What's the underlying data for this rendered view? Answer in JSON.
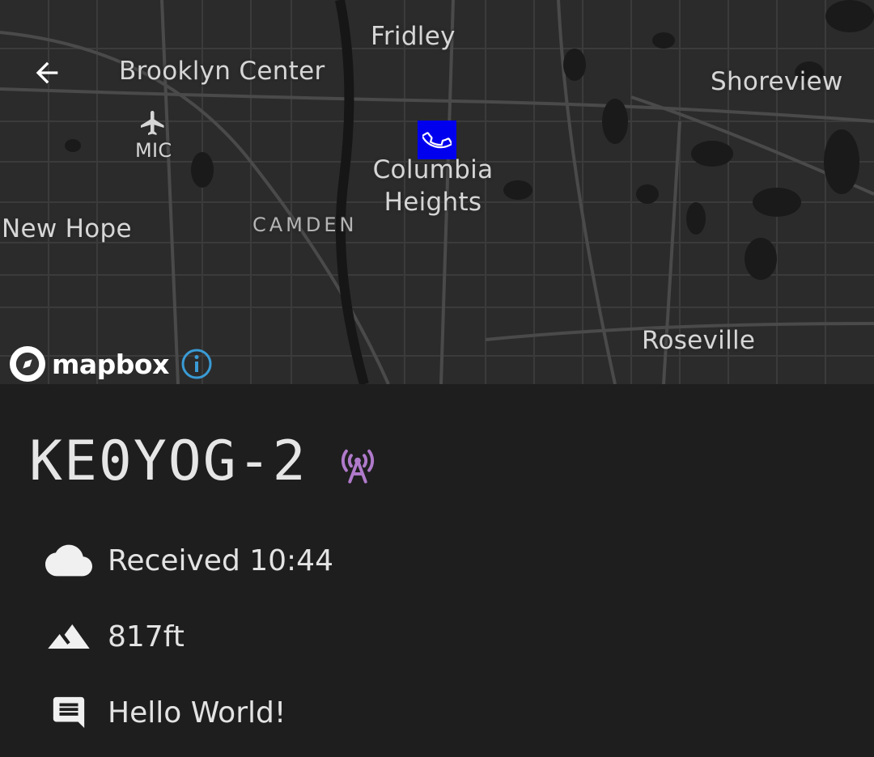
{
  "map": {
    "places": {
      "fridley": "Fridley",
      "brooklyn_center": "Brooklyn Center",
      "shoreview": "Shoreview",
      "mic": "MIC",
      "columbia_heights": "Columbia Heights",
      "new_hope": "New Hope",
      "camden": "CAMDEN",
      "roseville": "Roseville"
    },
    "attribution": "mapbox",
    "marker_color": "#0000ee"
  },
  "station": {
    "callsign": "KE0YOG-2",
    "tower_color": "#b07acb",
    "received": "Received 10:44",
    "altitude": "817ft",
    "comment": "Hello World!"
  },
  "icons": {
    "back": "arrow-left-icon",
    "airport": "airplane-icon",
    "marker": "phone-icon",
    "tower": "radio-tower-icon",
    "received": "cloud-icon",
    "altitude": "mountain-icon",
    "comment": "message-icon",
    "info": "info-icon"
  }
}
